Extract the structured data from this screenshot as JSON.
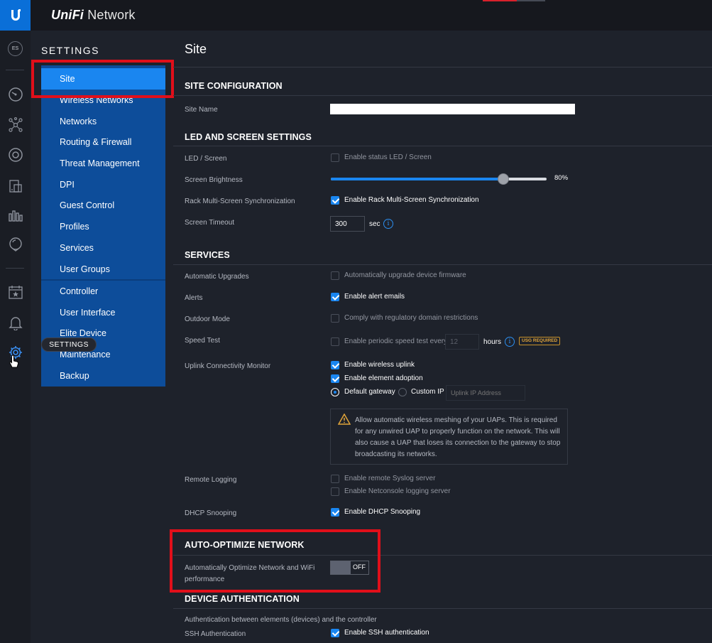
{
  "app": {
    "brand_prefix": "UniFi",
    "brand_suffix": " Network",
    "avatar": "ES"
  },
  "rail_icons": [
    "unifi-logo-icon",
    "dashboard-icon",
    "topology-icon",
    "clients-icon",
    "devices-icon",
    "statistics-icon",
    "insights-icon",
    "events-icon",
    "alerts-icon",
    "settings-icon"
  ],
  "settings": {
    "heading": "SETTINGS",
    "tooltip": "SETTINGS",
    "menu_group1": [
      "Site",
      "Wireless Networks",
      "Networks",
      "Routing & Firewall",
      "Threat Management",
      "DPI",
      "Guest Control",
      "Profiles",
      "Services",
      "User Groups"
    ],
    "menu_group2": [
      "Controller",
      "User Interface",
      "Elite Device",
      "Maintenance",
      "Backup"
    ],
    "active_item": "Site"
  },
  "main": {
    "title": "Site",
    "site_config": {
      "title": "SITE CONFIGURATION",
      "site_name_label": "Site Name",
      "site_name_value": ""
    },
    "led": {
      "title": "LED AND SCREEN SETTINGS",
      "led_label": "LED / Screen",
      "led_option": "Enable status LED / Screen",
      "led_checked": false,
      "brightness_label": "Screen Brightness",
      "brightness_value": 80,
      "brightness_text": "80%",
      "rack_label": "Rack Multi-Screen Synchronization",
      "rack_option": "Enable Rack Multi-Screen Synchronization",
      "rack_checked": true,
      "timeout_label": "Screen Timeout",
      "timeout_value": "300",
      "timeout_unit": "sec"
    },
    "services": {
      "title": "SERVICES",
      "auto_upgrades_label": "Automatic Upgrades",
      "auto_upgrades_option": "Automatically upgrade device firmware",
      "alerts_label": "Alerts",
      "alerts_option": "Enable alert emails",
      "outdoor_label": "Outdoor Mode",
      "outdoor_option": "Comply with regulatory domain restrictions",
      "speed_label": "Speed Test",
      "speed_option": "Enable periodic speed test every",
      "speed_hours_value": "12",
      "speed_unit": "hours",
      "usg_badge": "USG REQUIRED",
      "uplink_label": "Uplink Connectivity Monitor",
      "uplink_option1": "Enable wireless uplink",
      "uplink_option2": "Enable element adoption",
      "radio_default": "Default gateway",
      "radio_custom": "Custom IP",
      "uplink_ip_placeholder": "Uplink IP Address",
      "mesh_warning": "Allow automatic wireless meshing of your UAPs. This is required for any unwired UAP to properly function on the network. This will also cause a UAP that loses its connection to the gateway to stop broadcasting its networks.",
      "remote_logging_label": "Remote Logging",
      "remote_option1": "Enable remote Syslog server",
      "remote_option2": "Enable Netconsole logging server",
      "dhcp_label": "DHCP Snooping",
      "dhcp_option": "Enable DHCP Snooping"
    },
    "auto_optimize": {
      "title": "AUTO-OPTIMIZE NETWORK",
      "label_line1": "Automatically Optimize Network and WiFi",
      "label_line2": "performance",
      "toggle": "OFF"
    },
    "device_auth": {
      "title": "DEVICE AUTHENTICATION",
      "description": "Authentication between elements (devices) and the controller",
      "ssh_label": "SSH Authentication",
      "ssh_option": "Enable SSH authentication"
    }
  },
  "colors": {
    "accent": "#1a86f0",
    "menu_bg": "#0d4d9a",
    "highlight_red": "#e10f1a",
    "warning": "#e0a43a"
  }
}
